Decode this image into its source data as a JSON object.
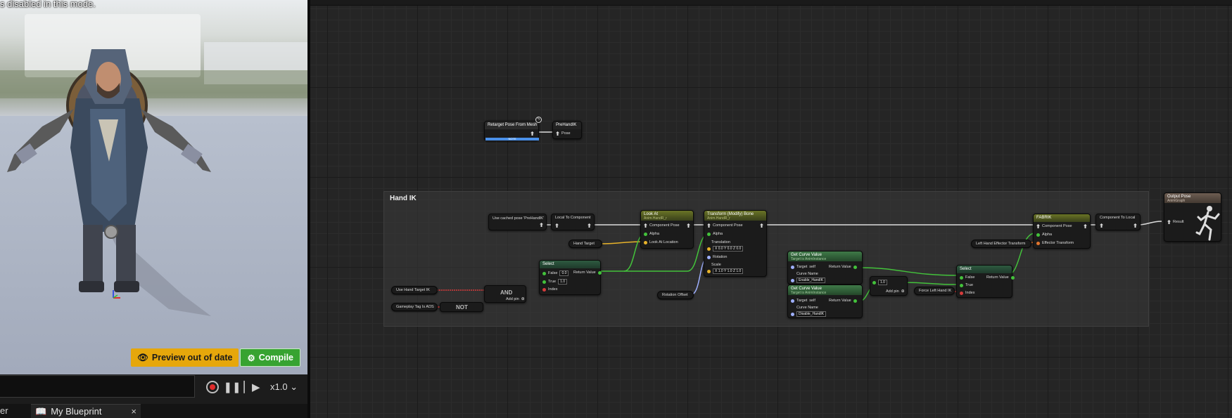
{
  "viewport": {
    "warning": "s disabled in this mode.",
    "preview_badge": "Preview out of date",
    "compile_label": "Compile",
    "colors": {
      "preview": "#e6a70b",
      "compile": "#37a331"
    }
  },
  "playback": {
    "speed": "x1.0",
    "icons": [
      "record-icon",
      "pause-icon",
      "step-forward-icon"
    ]
  },
  "tabs": {
    "partial": "er",
    "blueprint": "My Blueprint",
    "close": "×"
  },
  "graph": {
    "top_nodes": {
      "retarget": "Retarget Pose From Mesh",
      "retarget_bar": "NOTE",
      "prehandik_title": "PreHandIK",
      "prehandik_pin": "Pose"
    },
    "comment_title": "Hand IK",
    "nodes": {
      "cached_pose": "Use cached pose 'PreHandIK'",
      "local_to_component": "Local To Component",
      "look_at": {
        "title": "Look At",
        "sub": "Anim.HandR_r",
        "component_pose": "Component Pose",
        "alpha": "Alpha",
        "look_at_location": "Look At Location"
      },
      "hand_target": "Hand Target",
      "transform_bone": {
        "title": "Transform (Modify) Bone",
        "sub": "Anim.HandR_r",
        "component_pose": "Component Pose",
        "alpha": "Alpha",
        "translation": "Translation",
        "translation_vals": "X 0.0  Y 0.0  Z 0.0",
        "rotation": "Rotation",
        "scale": "Scale",
        "scale_vals": "X 1.0  Y 1.0  Z 1.0"
      },
      "select1": {
        "title": "Select",
        "false_label": "False",
        "false_val": "0.0",
        "true_label": "True",
        "true_val": "1.0",
        "index": "Index",
        "return_value": "Return Value"
      },
      "use_hand_target": "Use Hand Target IK",
      "gameplay_tag": "Gameplay Tag Is ADS",
      "and_label": "AND",
      "and_add_pin": "Add pin",
      "not_label": "NOT",
      "rotation_offset": "Rotation Offset",
      "curve1": {
        "title": "Get Curve Value",
        "sub": "Target is AnimInstance",
        "target": "Target",
        "target_val": "self",
        "curve_name": "Curve Name",
        "curve_val": "Enable_HandIK",
        "return_value": "Return Value"
      },
      "curve2": {
        "title": "Get Curve Value",
        "sub": "Target is AnimInstance",
        "target": "Target",
        "target_val": "self",
        "curve_name": "Curve Name",
        "curve_val": "Disable_HandIK",
        "return_value": "Return Value"
      },
      "or_node": {
        "value": "1.0",
        "add_pin": "Add pin"
      },
      "force_left": "Force Left Hand IK",
      "select2": {
        "title": "Select",
        "false_label": "False",
        "true_label": "True",
        "index": "Index",
        "return_value": "Return Value"
      },
      "left_effector": "Left Hand Effector Transform",
      "fabrik": {
        "title": "FABRIK",
        "component_pose": "Component Pose",
        "alpha": "Alpha",
        "effector": "Effector Transform"
      },
      "component_to_local": "Component To Local",
      "output_pose": {
        "title": "Output Pose",
        "sub": "AnimGraph",
        "result": "Result"
      }
    }
  }
}
